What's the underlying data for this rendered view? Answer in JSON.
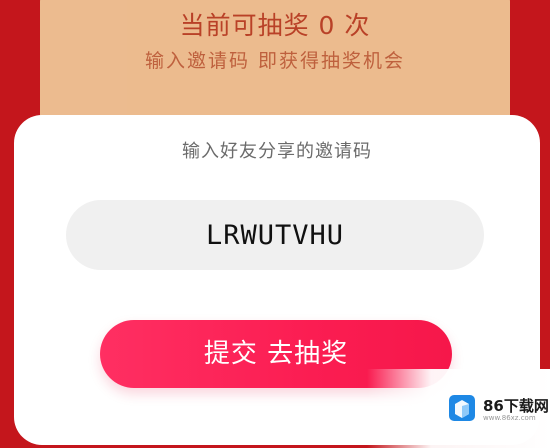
{
  "background": {
    "lottery_count_text": "当前可抽奖 0 次",
    "invite_hint": "输入邀请码 即获得抽奖机会"
  },
  "dialog": {
    "title": "输入好友分享的邀请码",
    "code_value": "LRWUTVHU",
    "submit_label": "提交 去抽奖"
  },
  "watermark": {
    "site_name": "86下载网",
    "site_url": "www.86xz.com"
  },
  "colors": {
    "page_red": "#c4161c",
    "banner_gold": "#f3d8a3",
    "button_pink": "#fb1d52",
    "input_gray": "#f0f0f0"
  }
}
